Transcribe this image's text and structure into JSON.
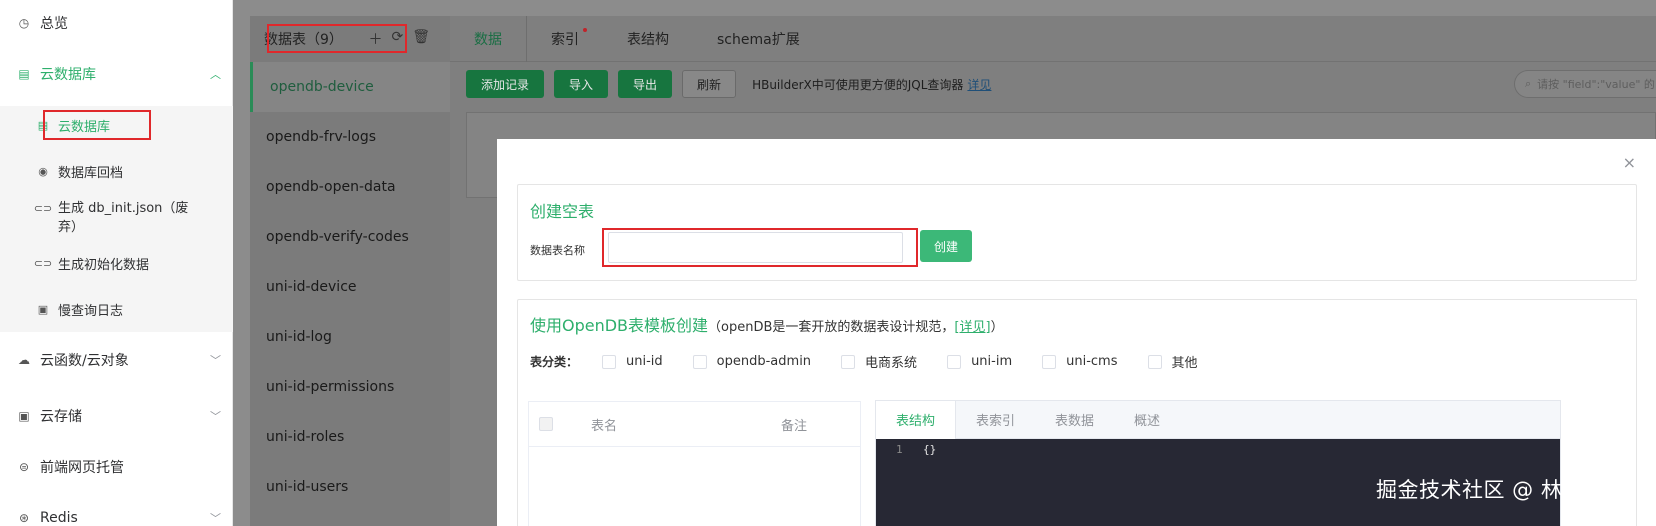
{
  "sidebar": {
    "overview": "总览",
    "cloud_db": "云数据库",
    "sub_items": [
      "云数据库",
      "数据库回档",
      "生成 db_init.json（废弃）",
      "生成初始化数据",
      "慢查询日志"
    ],
    "cloud_functions": "云函数/云对象",
    "cloud_storage": "云存储",
    "frontend_hosting": "前端网页托管",
    "redis": "Redis"
  },
  "tables_panel": {
    "header": "数据表（9）",
    "add_icon": "plus-icon",
    "refresh_icon": "refresh-icon",
    "delete_icon": "trash-icon",
    "items": [
      "opendb-device",
      "opendb-frv-logs",
      "opendb-open-data",
      "opendb-verify-codes",
      "uni-id-device",
      "uni-id-log",
      "uni-id-permissions",
      "uni-id-roles",
      "uni-id-users"
    ]
  },
  "tabs": [
    "数据",
    "索引",
    "表结构",
    "schema扩展"
  ],
  "toolbar": {
    "add_record": "添加记录",
    "import": "导入",
    "export": "导出",
    "refresh": "刷新",
    "hint": "HBuilderX中可使用更方便的JQL查询器",
    "hint_link": "详见",
    "search_placeholder": "请按 \"field\":\"value\" 的"
  },
  "modal": {
    "close": "×",
    "create_empty_title": "创建空表",
    "table_name_label": "数据表名称",
    "table_name_value": "",
    "create_button": "创建",
    "template_title": "使用OpenDB表模板创建",
    "template_desc": "（openDB是一套开放的数据表设计规范，",
    "template_link": "[详见]",
    "template_desc_end": "）",
    "category_label": "表分类：",
    "categories": [
      "uni-id",
      "opendb-admin",
      "电商系统",
      "uni-im",
      "uni-cms",
      "其他"
    ],
    "table_cols": {
      "name": "表名",
      "note": "备注"
    },
    "preview_tabs": [
      "表结构",
      "表索引",
      "表数据",
      "概述"
    ],
    "code_line": "1",
    "code_text": "{}"
  },
  "watermark": "掘金技术社区 @ 林太白",
  "colors": {
    "accent": "#2eaf6c",
    "highlight_box": "#e0282b",
    "code_bg": "#272834"
  }
}
